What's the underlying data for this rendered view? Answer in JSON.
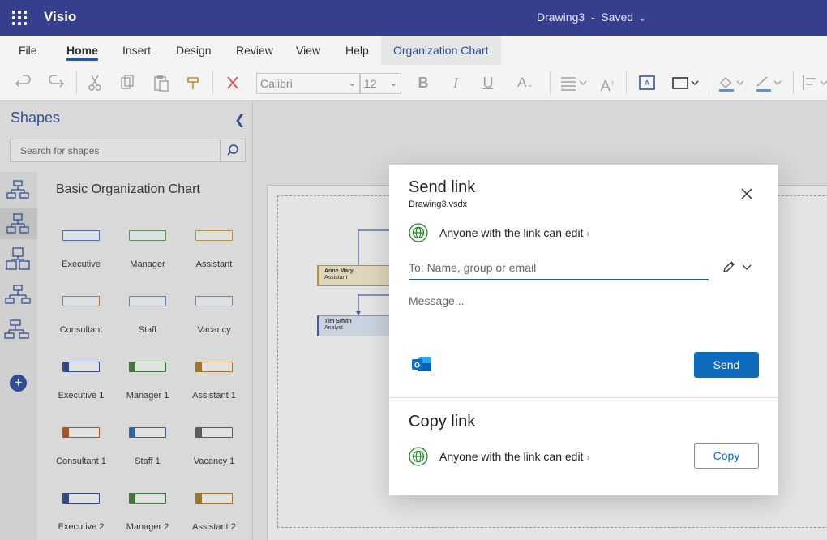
{
  "app": {
    "name": "Visio",
    "doc_title": "Drawing3",
    "save_status": "Saved"
  },
  "menu": {
    "tabs": [
      "File",
      "Home",
      "Insert",
      "Design",
      "Review",
      "View",
      "Help",
      "Organization Chart"
    ],
    "active": "Home"
  },
  "ribbon": {
    "font_name": "Calibri",
    "font_size": "12"
  },
  "shapes_panel": {
    "title": "Shapes",
    "search_placeholder": "Search for shapes",
    "stencil_title": "Basic Organization Chart",
    "shapes": [
      {
        "label": "Executive",
        "color": "#4a6fb5"
      },
      {
        "label": "Manager",
        "color": "#5b9a58"
      },
      {
        "label": "Assistant",
        "color": "#c79a3a"
      },
      {
        "label": "Consultant",
        "color": "#c8743a"
      },
      {
        "label": "Staff",
        "color": "#5a8fc0"
      },
      {
        "label": "Vacancy",
        "color": "#8c8c8c"
      },
      {
        "label": "Executive 1",
        "color": "#2e4a8c"
      },
      {
        "label": "Manager 1",
        "color": "#3f7a3c"
      },
      {
        "label": "Assistant 1",
        "color": "#a67c20"
      },
      {
        "label": "Consultant 1",
        "color": "#b0561c"
      },
      {
        "label": "Staff 1",
        "color": "#2e6aa6"
      },
      {
        "label": "Vacancy 1",
        "color": "#5a5a5a"
      },
      {
        "label": "Executive 2",
        "color": "#2e4a8c"
      },
      {
        "label": "Manager 2",
        "color": "#3f7a3c"
      },
      {
        "label": "Assistant 2",
        "color": "#a67c20"
      }
    ]
  },
  "canvas": {
    "nodes": [
      {
        "name": "Anne Mary",
        "title": "Assistant"
      },
      {
        "name": "Tim Smith",
        "title": "Analyst"
      }
    ]
  },
  "send_link": {
    "title": "Send link",
    "file_name": "Drawing3.vsdx",
    "permission": "Anyone with the link can edit",
    "to_placeholder": "To: Name, group or email",
    "message_placeholder": "Message...",
    "send_label": "Send"
  },
  "copy_link": {
    "title": "Copy link",
    "permission": "Anyone with the link can edit",
    "copy_label": "Copy"
  }
}
